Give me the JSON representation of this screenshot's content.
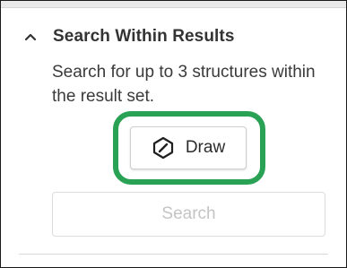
{
  "section": {
    "title": "Search Within Results",
    "expanded": true,
    "collapse_icon": "chevron-up-icon",
    "description": "Search for up to 3 structures within the result set."
  },
  "draw_button": {
    "label": "Draw",
    "icon": "pencil-icon",
    "highlighted": true
  },
  "search_button": {
    "label": "Search",
    "disabled": true
  },
  "colors": {
    "highlight": "#2aa256",
    "text": "#333333",
    "disabled_text": "#c4c4c4"
  }
}
